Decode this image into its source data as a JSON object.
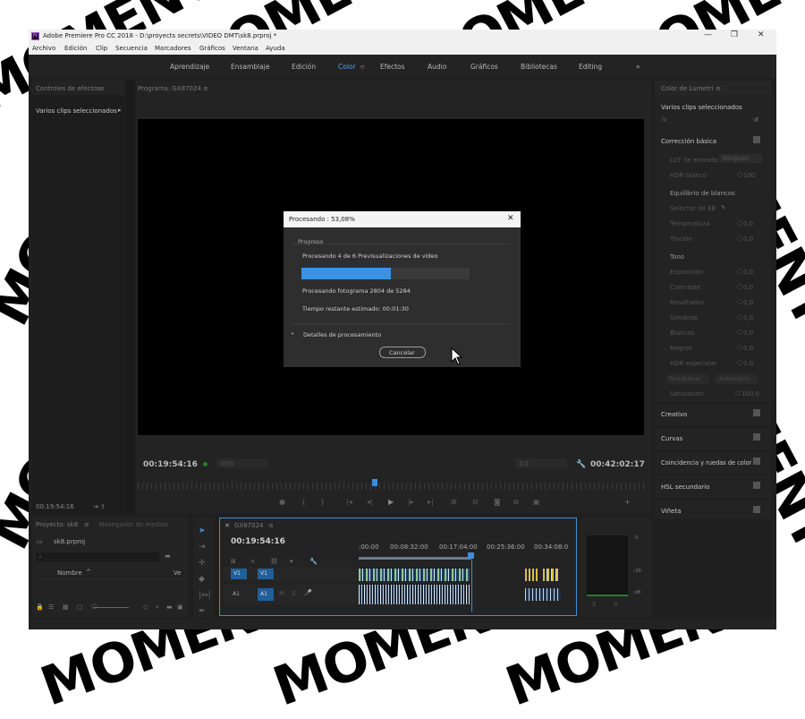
{
  "watermark": {
    "text": "MOMENT"
  },
  "window": {
    "title": "Adobe Premiere Pro CC 2018 - D:\\proyects secrets\\VIDEO DMT\\sk8.prproj *",
    "app_icon": "Pr",
    "controls": {
      "minimize": "—",
      "maximize": "❐",
      "close": "✕"
    }
  },
  "menu": [
    "Archivo",
    "Edición",
    "Clip",
    "Secuencia",
    "Marcadores",
    "Gráficos",
    "Ventana",
    "Ayuda"
  ],
  "workspaces": {
    "tabs": [
      "Aprendizaje",
      "Ensamblaje",
      "Edición",
      "Color",
      "Efectos",
      "Audio",
      "Gráficos",
      "Bibliotecas",
      "Editing"
    ],
    "active": "Color",
    "overflow": "»"
  },
  "effects_controls": {
    "title": "Controles de efectos",
    "subtitle": "Varios clips seleccionados",
    "timecode": "00:19:54:16"
  },
  "program": {
    "title": "Programa: GX87024",
    "timecode_left": "00:19:54:16",
    "zoom": "50%",
    "quality": "1/2",
    "timecode_right": "00:42:02:17"
  },
  "lumetri": {
    "title": "Color de Lumetri",
    "subtitle": "Varios clips seleccionados",
    "fx": "fx",
    "basic": {
      "title": "Corrección básica",
      "lut_label": "LUT de entrada",
      "lut_value": "Ninguno",
      "hdr_label": "HDR blanco",
      "hdr_value": "100",
      "wb_title": "Equilibrio de blancos",
      "eb_selector": "Selector de EB",
      "temperature": "Temperatura",
      "temperature_val": "0,0",
      "tint": "Tinción",
      "tint_val": "0,0",
      "tone_title": "Tono",
      "rows": [
        {
          "label": "Exposición",
          "value": "0,0"
        },
        {
          "label": "Contraste",
          "value": "0,0"
        },
        {
          "label": "Resaltados",
          "value": "0,0"
        },
        {
          "label": "Sombras",
          "value": "0,0"
        },
        {
          "label": "Blancos",
          "value": "0,0"
        },
        {
          "label": "Negros",
          "value": "0,0"
        },
        {
          "label": "HDR especular",
          "value": "0,0"
        }
      ],
      "reset_btn": "Restablecer",
      "auto_btn": "Automático",
      "saturation": "Saturación",
      "saturation_val": "100,0"
    },
    "sections": [
      "Creativo",
      "Curvas",
      "Coincidencia y ruedas de color",
      "HSL secundario",
      "Viñeta"
    ]
  },
  "project": {
    "tab1": "Proyecto: sk8",
    "tab2": "Navegador de medios",
    "file": "sk8.prproj",
    "column": "Nombre",
    "column2": "Ve"
  },
  "timeline": {
    "title": "GX87024",
    "timecode": "00:19:54:16",
    "ruler": [
      ":00:00",
      "00:08:32:00",
      "00:17:04:00",
      "00:25:36:00",
      "00:34:08:0"
    ],
    "tracks": [
      {
        "name": "V1",
        "target": "V1"
      },
      {
        "name": "A1",
        "target": "A1"
      }
    ]
  },
  "meter": {
    "labels": [
      "0",
      "-36",
      "dB"
    ]
  },
  "dialog": {
    "title": "Procesando : 53,08%",
    "group": "Progreso",
    "line1": "Procesando 4 de 6 Previsualizaciones de vídeo",
    "progress": 0.53,
    "line2": "Procesando fotograma 2804 de 5284",
    "line3": "Tiempo restante estimado: 00:01:30",
    "details": "Detalles de procesamiento",
    "cancel": "Cancelar",
    "close": "✕"
  }
}
